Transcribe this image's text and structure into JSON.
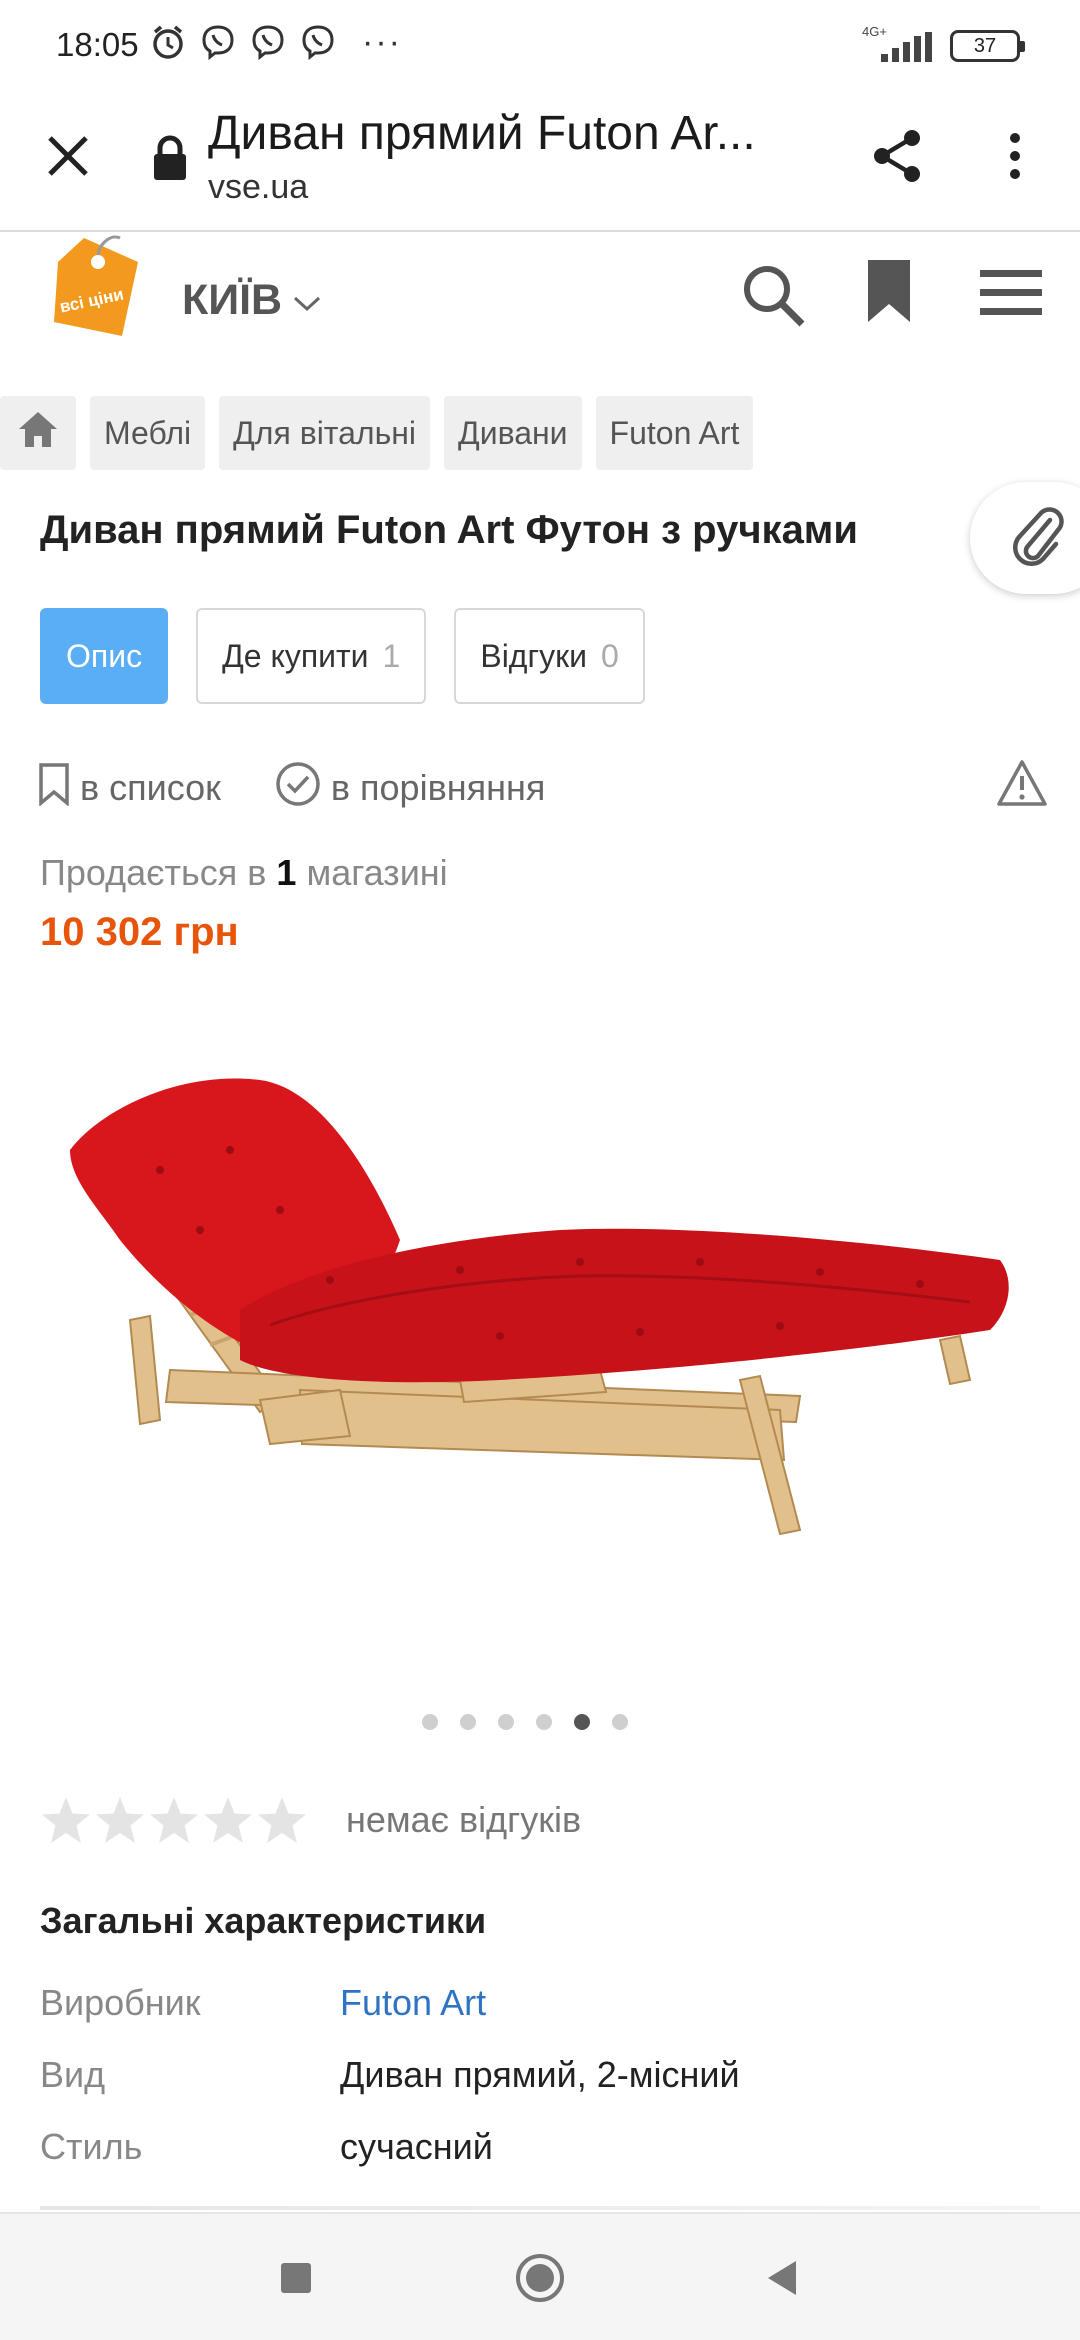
{
  "status_bar": {
    "time": "18:05",
    "icons": [
      "alarm-icon",
      "viber-icon",
      "viber-icon",
      "viber-icon"
    ],
    "more": "···",
    "network": "4G+",
    "battery": "37"
  },
  "browser": {
    "title": "Диван прямий Futon Ar...",
    "url": "vse.ua"
  },
  "site_header": {
    "logo_text": "всі ціни",
    "city": "КИЇВ"
  },
  "breadcrumb": [
    "Меблі",
    "Для вітальні",
    "Дивани",
    "Futon Art"
  ],
  "product": {
    "title": "Диван прямий Futon Art Футон з ручками",
    "sold_prefix": "Продається в",
    "sold_count": "1",
    "sold_suffix": "магазині",
    "price": "10 302 грн",
    "image_dots": 6,
    "active_dot": 5
  },
  "tabs": [
    {
      "label": "Опис",
      "count": "",
      "active": true
    },
    {
      "label": "Де купити",
      "count": "1",
      "active": false
    },
    {
      "label": "Відгуки",
      "count": "0",
      "active": false
    }
  ],
  "actions": {
    "wishlist": "в список",
    "compare": "в порівняння"
  },
  "rating": {
    "stars": 0,
    "text": "немає відгуків"
  },
  "specs": {
    "title": "Загальні характеристики",
    "rows": [
      {
        "key": "Виробник",
        "value": "Futon Art"
      },
      {
        "key": "Вид",
        "value": "Диван прямий, 2-місний"
      },
      {
        "key": "Стиль",
        "value": "сучасний"
      }
    ]
  },
  "colors": {
    "accent_tab": "#5aaef5",
    "price": "#e8550a",
    "link": "#2f73c4",
    "logo": "#f39a1e",
    "sofa": "#d8171c"
  },
  "nav": [
    "recents-icon",
    "home-icon",
    "back-icon"
  ]
}
